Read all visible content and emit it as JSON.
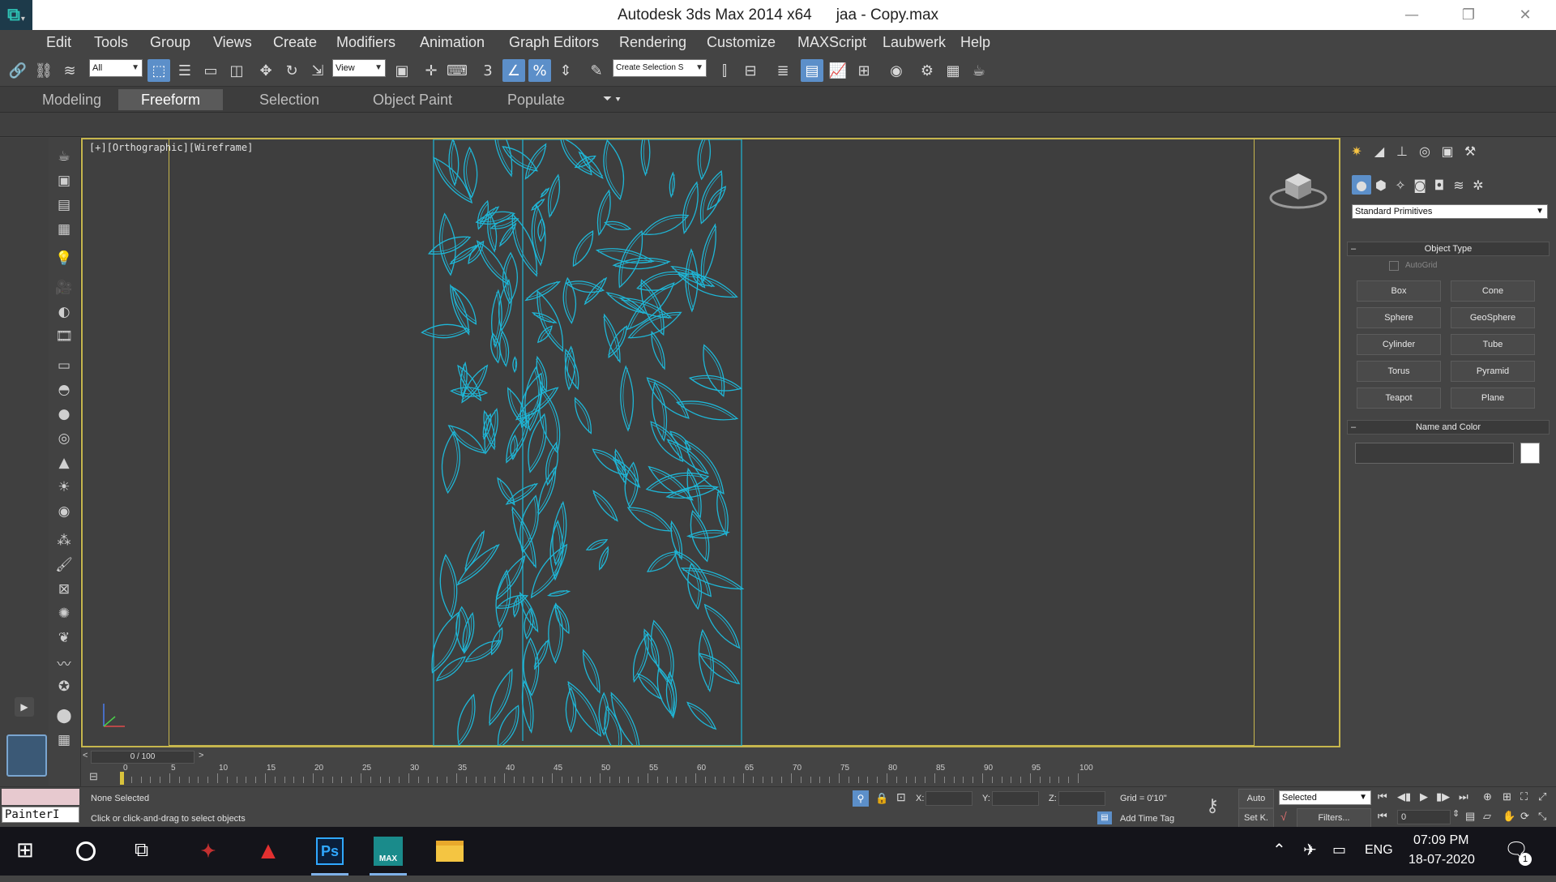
{
  "window": {
    "logo_glyph": "⧉",
    "title_app": "Autodesk 3ds Max  2014 x64",
    "title_file": "jaa - Copy.max",
    "minimize": "—",
    "maximize": "❐",
    "close": "✕"
  },
  "menu": [
    "Edit",
    "Tools",
    "Group",
    "Views",
    "Create",
    "Modifiers",
    "Animation",
    "Graph Editors",
    "Rendering",
    "Customize",
    "MAXScript",
    "Laubwerk",
    "Help"
  ],
  "toolbar": {
    "selection_filter": "All",
    "ref_coord": "View",
    "named_selection": "Create Selection S",
    "snap_angle_label": "3",
    "percent_label": "%"
  },
  "ribbon": {
    "tabs": [
      "Modeling",
      "Freeform",
      "Selection",
      "Object Paint",
      "Populate"
    ],
    "active_tab": "Freeform"
  },
  "viewport": {
    "label_plus": "[+]",
    "label_view": "[Orthographic]",
    "label_shade": "[Wireframe]",
    "wire_color": "#1fb6d6"
  },
  "command_panel": {
    "category": "Standard Primitives",
    "rollout_object_type": "Object Type",
    "autogrid": "AutoGrid",
    "primitives": [
      "Box",
      "Cone",
      "Sphere",
      "GeoSphere",
      "Cylinder",
      "Tube",
      "Torus",
      "Pyramid",
      "Teapot",
      "Plane"
    ],
    "rollout_name_color": "Name and Color"
  },
  "timeline": {
    "frame_counter": "0 / 100",
    "ticks": [
      "0",
      "5",
      "10",
      "15",
      "20",
      "25",
      "30",
      "35",
      "40",
      "45",
      "50",
      "55",
      "60",
      "65",
      "70",
      "75",
      "80",
      "85",
      "90",
      "95",
      "100"
    ]
  },
  "status": {
    "maxscript_listener": "PainterI",
    "selection": "None Selected",
    "prompt": "Click or click-and-drag to select objects",
    "x_label": "X:",
    "y_label": "Y:",
    "z_label": "Z:",
    "grid": "Grid = 0'10\"",
    "add_time_tag": "Add Time Tag",
    "auto_key": "Auto",
    "set_key": "Set K.",
    "key_mode": "Selected",
    "filters": "Filters...",
    "current_frame": "0"
  },
  "taskbar": {
    "language": "ENG",
    "time": "07:09 PM",
    "date": "18-07-2020",
    "notification_count": "1",
    "apps": [
      "Acer",
      "AutoCAD",
      "Ps",
      "MAX",
      "Explorer"
    ]
  }
}
